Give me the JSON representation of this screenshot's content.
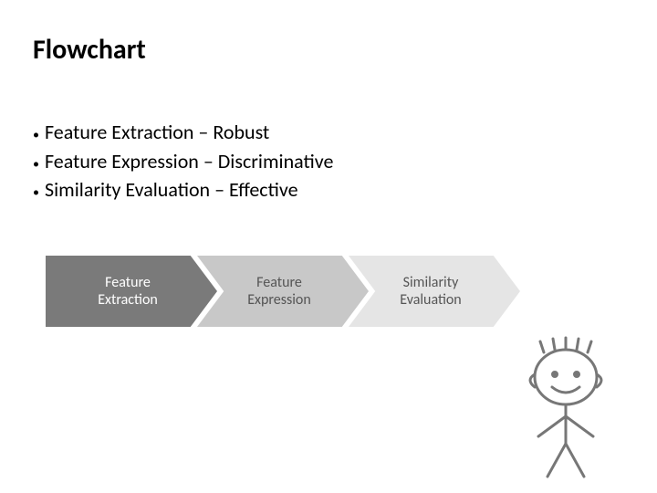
{
  "title": "Flowchart",
  "bullets": [
    "Feature Extraction  – Robust",
    "Feature Expression – Discriminative",
    "Similarity Evaluation – Effective"
  ],
  "flow": {
    "steps": [
      {
        "label": "Feature\nExtraction",
        "fill": "#7a7a7a"
      },
      {
        "label": "Feature\nExpression",
        "fill": "#c8c8c8"
      },
      {
        "label": "Similarity\nEvaluation",
        "fill": "#e5e5e5"
      }
    ]
  }
}
